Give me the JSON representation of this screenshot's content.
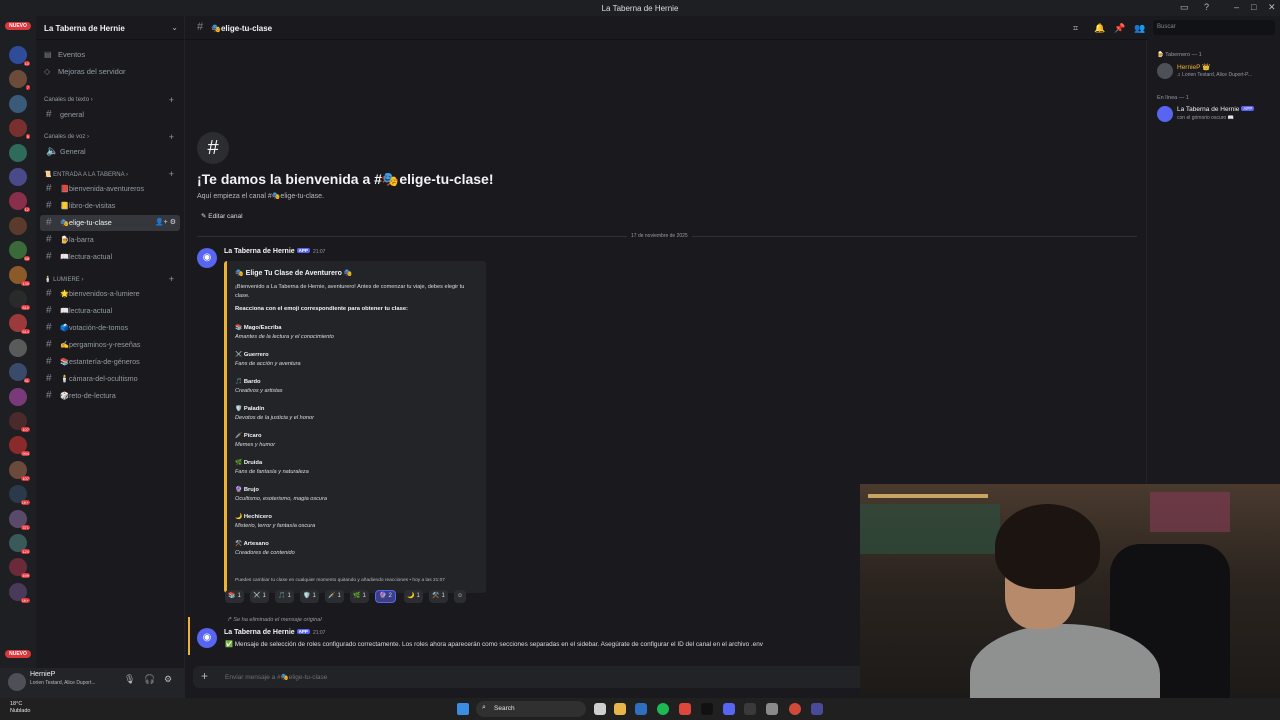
{
  "window": {
    "title": "La Taberna de Hernie"
  },
  "rail": {
    "nuevo_top": "NUEVO",
    "nuevo_bottom": "NUEVO",
    "servers": [
      {
        "color": "#2f4b9a",
        "badge": "10"
      },
      {
        "color": "#6d4b3a",
        "badge": "7"
      },
      {
        "color": "#3a5a7a",
        "badge": ""
      },
      {
        "color": "#7a2f2f",
        "badge": "5"
      },
      {
        "color": "#2f6a5a",
        "badge": ""
      },
      {
        "color": "#4a4a8a",
        "badge": ""
      },
      {
        "color": "#8a2f4b",
        "badge": "12"
      },
      {
        "color": "#5a3a2a",
        "badge": ""
      },
      {
        "color": "#3a6a3a",
        "badge": "58"
      },
      {
        "color": "#8a5a2a",
        "badge": "139"
      },
      {
        "color": "#2a2a2a",
        "badge": "810"
      },
      {
        "color": "#9a3a3a",
        "badge": "814"
      },
      {
        "color": "#5a5a5a",
        "badge": ""
      },
      {
        "color": "#3a4a6a",
        "badge": "81"
      },
      {
        "color": "#7a3a7a",
        "badge": ""
      },
      {
        "color": "#4a2a2a",
        "badge": "107"
      },
      {
        "color": "#8a2a2a",
        "badge": "994"
      },
      {
        "color": "#6a4a3a",
        "badge": "107"
      },
      {
        "color": "#2a3a4a",
        "badge": "1K+"
      },
      {
        "color": "#5a4a6a",
        "badge": "371"
      },
      {
        "color": "#3a5a5a",
        "badge": "124"
      },
      {
        "color": "#6a2a3a",
        "badge": "499"
      },
      {
        "color": "#4a3a5a",
        "badge": "1K+"
      }
    ]
  },
  "sidebar": {
    "server_name": "La Taberna de Hernie",
    "events": "Eventos",
    "boost": "Mejoras del servidor",
    "cat_text": "Canales de texto",
    "ch_general": "general",
    "cat_voice": "Canales de voz",
    "voice_general": "General",
    "cat_entrada": "📜 ENTRADA A LA TABERNA",
    "entrada": [
      "📕bienvenida-aventureros",
      "📒libro-de-visitas",
      "🎭elige-tu-clase",
      "🍺la-barra",
      "📖lectura-actual"
    ],
    "cat_lumiere": "🕯️ LUMIERE",
    "lumiere": [
      "🌟bienvenidos-a-lumiere",
      "📖lectura-actual",
      "🗳️votación-de-tomos",
      "✍️pergaminos-y-reseñas",
      "📚estantería-de-géneros",
      "🕯️cámara-del-ocultismo",
      "🎲reto-de-lectura"
    ]
  },
  "user": {
    "name": "HernieP",
    "status": "Lorien Testard, Alice Duport..."
  },
  "header": {
    "channel": "🎭elige-tu-clase",
    "search_placeholder": "Buscar"
  },
  "welcome": {
    "title": "¡Te damos la bienvenida a #🎭elige-tu-clase!",
    "subtitle": "Aquí empieza el canal #🎭elige-tu-clase.",
    "edit": "✎ Editar canal",
    "date": "17 de noviembre de 2025"
  },
  "message1": {
    "author": "La Taberna de Hernie",
    "tag": "APP",
    "time": "21:07",
    "embed_title": "🎭 Elige Tu Clase de Aventurero 🎭",
    "embed_desc": "¡Bienvenido a La Taberna de Hernie, aventurero! Antes de comenzar tu viaje, debes elegir tu clase.",
    "embed_head": "Reacciona con el emoji correspondiente para obtener tu clase:",
    "classes": [
      {
        "name": "📚 Mago/Escriba",
        "desc": "Amantes de la lectura y el conocimiento"
      },
      {
        "name": "⚔️ Guerrero",
        "desc": "Fans de acción y aventura"
      },
      {
        "name": "🎵 Bardo",
        "desc": "Creativos y artistas"
      },
      {
        "name": "🛡️ Paladín",
        "desc": "Devotos de la justicia y el honor"
      },
      {
        "name": "🗡️ Pícaro",
        "desc": "Memes y humor"
      },
      {
        "name": "🌿 Druida",
        "desc": "Fans de fantasía y naturaleza"
      },
      {
        "name": "🔮 Brujo",
        "desc": "Ocultismo, esoterismo, magia oscura"
      },
      {
        "name": "🌙 Hechicero",
        "desc": "Misterio, terror y fantasía oscura"
      },
      {
        "name": "⚒️ Artesano",
        "desc": "Creadores de contenido"
      }
    ],
    "embed_footer": "Puedes cambiar tu clase en cualquier momento quitando y añadiendo reacciones • hoy a las 21:07",
    "reactions": [
      {
        "emoji": "📚",
        "count": "1"
      },
      {
        "emoji": "⚔️",
        "count": "1"
      },
      {
        "emoji": "🎵",
        "count": "1"
      },
      {
        "emoji": "🛡️",
        "count": "1"
      },
      {
        "emoji": "🗡️",
        "count": "1"
      },
      {
        "emoji": "🌿",
        "count": "1"
      },
      {
        "emoji": "🔮",
        "count": "2"
      },
      {
        "emoji": "🌙",
        "count": "1"
      },
      {
        "emoji": "⚒️",
        "count": "1"
      },
      {
        "emoji": "☺",
        "count": ""
      }
    ]
  },
  "message2": {
    "reply": "Se ha eliminado el mensaje original",
    "author": "La Taberna de Hernie",
    "tag": "APP",
    "time": "21:07",
    "text": "✅ Mensaje de selección de roles configurado correctamente. Los roles ahora aparecerán como secciones separadas en el sidebar. Asegúrate de configurar el ID del canal en el archivo .env"
  },
  "composer": {
    "placeholder": "Enviar mensaje a #🎭elige-tu-clase"
  },
  "members": {
    "group1": "🍺 Tabernero — 1",
    "m1_name": "HernieP 👑",
    "m1_status": "♫ Lorien Testard, Alice Duport-P...",
    "group2": "En línea — 1",
    "m2_name": "La Taberna de Hernie",
    "m2_tag": "APP",
    "m2_status": "con el grimorio oscuro 📖"
  },
  "taskbar": {
    "temp": "18°C",
    "weather": "Nublado",
    "search": "Search"
  }
}
